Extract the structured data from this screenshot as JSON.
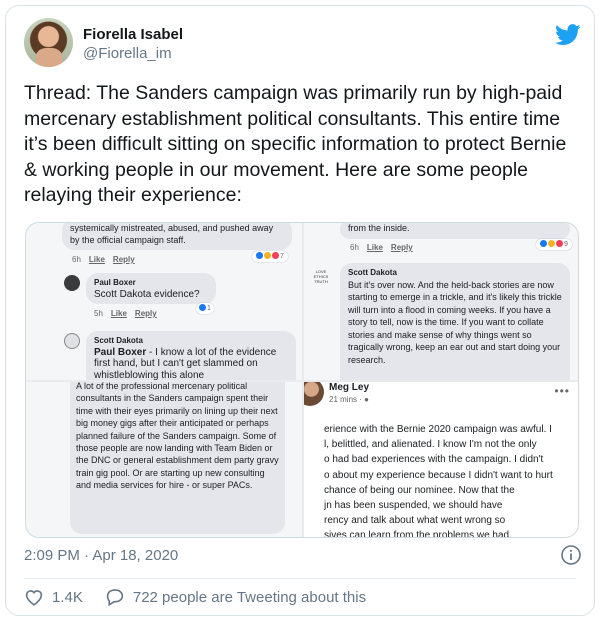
{
  "tweet": {
    "display_name": "Fiorella Isabel",
    "handle": "@Fiorella_im",
    "text": "Thread: The Sanders campaign was primarily run by high-paid mercenary establishment political consultants. This entire time it’s been difficult sitting on specific information to protect Bernie & working people in our movement.  Here are some people relaying their experience:",
    "timestamp": "2:09 PM · Apr 18, 2020",
    "likes": "1.4K",
    "tweeting_about": "722 people are Tweeting about this",
    "brand_color": "#1da1f2"
  },
  "media": {
    "panel1": {
      "top_text": "systemically mistreated, abused, and pushed away by the official campaign staff.",
      "meta_time": "6h",
      "like": "Like",
      "reply": "Reply",
      "react_count": "7",
      "c2_name": "Paul Boxer",
      "c2_text": "Scott Dakota evidence?",
      "c2_meta_time": "5h",
      "c2_react_count": "1",
      "c3_name": "Scott Dakota",
      "c3_text_bold": "Paul Boxer",
      "c3_text": " - I know a lot of the evidence first hand, but I can't get slammed on whistleblowing this alone"
    },
    "panel2": {
      "top_text": "from the inside.",
      "meta_time": "6h",
      "like": "Like",
      "reply": "Reply",
      "react_count": "9",
      "badge": "LOVE ETHICS TRUTH",
      "name": "Scott Dakota",
      "text": "But it's over now. And the held-back stories are now starting to emerge in a trickle, and it's likely this trickle will turn into a flood in coming weeks. If you have a story to tell, now is the time. If you want to collate stories and make sense of why things went so tragically wrong, keep an ear out and start doing your research."
    },
    "panel3": {
      "text": "A lot of the professional mercenary political consultants in the Sanders campaign spent their time with their eyes primarily on lining up their next big money gigs after their anticipated or perhaps planned failure of the Sanders campaign. Some of those people are now landing with Team Biden or the DNC or general establishment dem party gravy train gig pool. Or are starting up new consulting and media services for hire - or super PACs."
    },
    "panel4": {
      "name": "Meg Ley",
      "time": "21 mins · ",
      "text_lines": [
        "erience with the Bernie 2020 campaign was awful. I",
        "l, belittled, and alienated. I know I'm not the only",
        "o had bad experiences with the campaign. I didn't",
        "o about my experience because I didn't want to hurt",
        "chance of being our nominee. Now that the",
        "jn has been suspended, we should have",
        "rency and talk about what went wrong so",
        "sives can learn from the problems we had."
      ]
    }
  }
}
